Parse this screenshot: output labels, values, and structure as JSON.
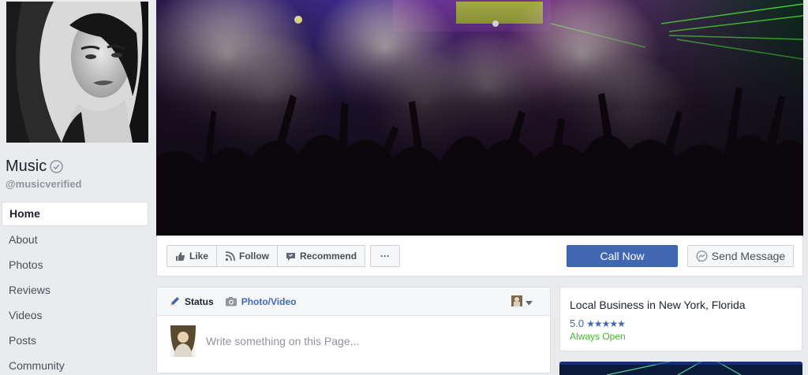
{
  "page": {
    "name": "Music",
    "username": "@musicverified"
  },
  "nav": {
    "items": [
      {
        "label": "Home",
        "active": true
      },
      {
        "label": "About"
      },
      {
        "label": "Photos"
      },
      {
        "label": "Reviews"
      },
      {
        "label": "Videos"
      },
      {
        "label": "Posts"
      },
      {
        "label": "Community"
      }
    ]
  },
  "actions": {
    "like": "Like",
    "follow": "Follow",
    "recommend": "Recommend",
    "more": "···",
    "call": "Call Now",
    "message": "Send Message"
  },
  "composer": {
    "tab_status": "Status",
    "tab_photo": "Photo/Video",
    "placeholder": "Write something on this Page..."
  },
  "info": {
    "category": "Local Business in New York, Florida",
    "rating": "5.0",
    "stars": "★★★★★",
    "rating_value": 5,
    "hours": "Always Open"
  },
  "colors": {
    "brand": "#4267b2",
    "open": "#42b72a",
    "background": "#e9ebee"
  }
}
